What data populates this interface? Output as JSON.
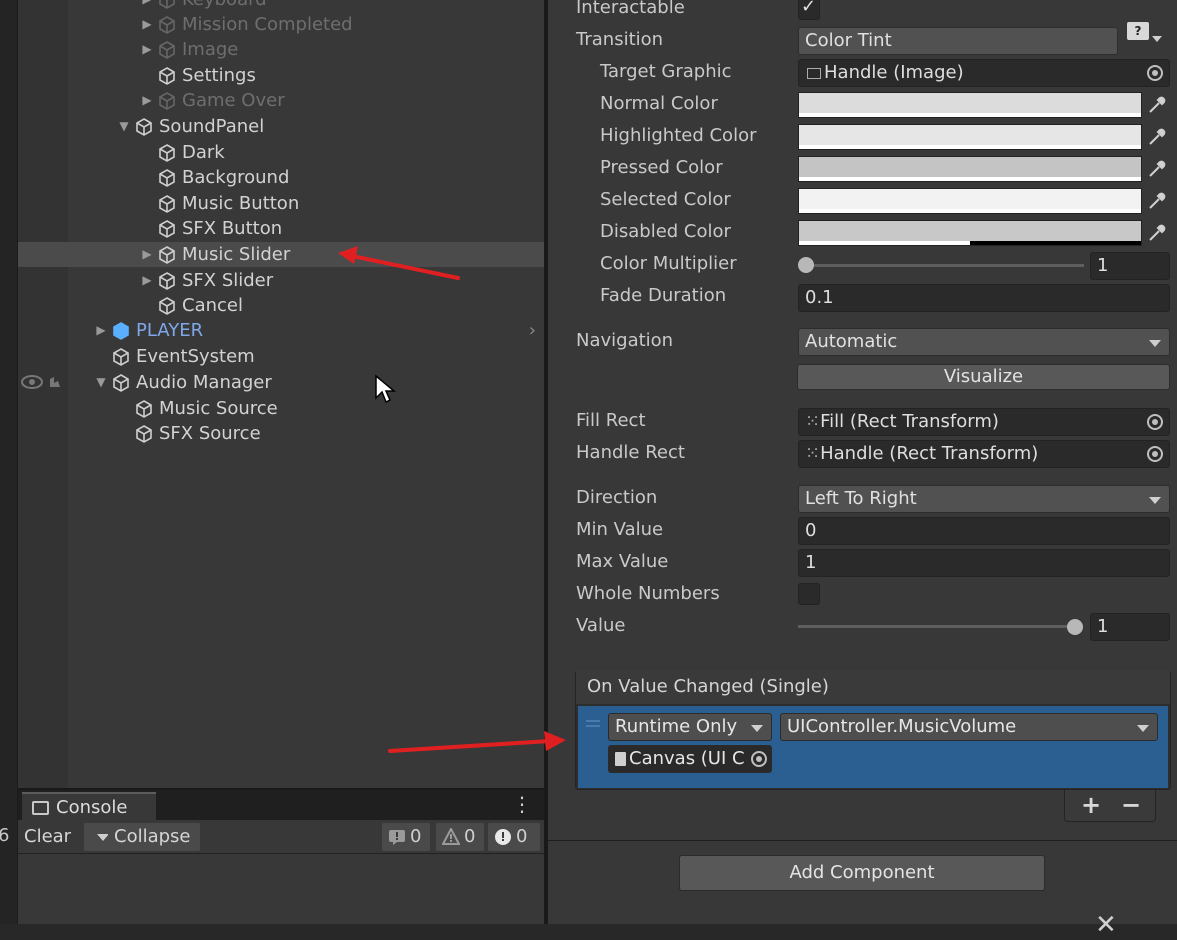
{
  "hierarchy": {
    "items": [
      {
        "label": "Keyboard",
        "state": "disabled"
      },
      {
        "label": "Mission Completed",
        "state": "disabled"
      },
      {
        "label": "Image",
        "state": "disabled"
      },
      {
        "label": "Settings",
        "state": "normal"
      },
      {
        "label": "Game Over",
        "state": "disabled"
      },
      {
        "label": "SoundPanel",
        "state": "expanded"
      },
      {
        "label": "Dark",
        "state": "normal"
      },
      {
        "label": "Background",
        "state": "normal"
      },
      {
        "label": "Music Button",
        "state": "normal"
      },
      {
        "label": "SFX Button",
        "state": "normal"
      },
      {
        "label": "Music Slider",
        "state": "selected"
      },
      {
        "label": "SFX Slider",
        "state": "collapsed"
      },
      {
        "label": "Cancel",
        "state": "normal"
      },
      {
        "label": "PLAYER",
        "state": "prefab"
      },
      {
        "label": "EventSystem",
        "state": "normal"
      },
      {
        "label": "Audio Manager",
        "state": "expanded"
      },
      {
        "label": "Music Source",
        "state": "normal"
      },
      {
        "label": "SFX Source",
        "state": "normal"
      }
    ]
  },
  "console": {
    "tab_label": "Console",
    "clear_label": "Clear",
    "collapse_label": "Collapse",
    "log_count": "0",
    "warning_count": "0",
    "error_count": "0",
    "edge_text": "6"
  },
  "inspector": {
    "interactable_label": "Interactable",
    "interactable_checked": true,
    "transition_label": "Transition",
    "transition_value": "Color Tint",
    "target_graphic_label": "Target Graphic",
    "target_graphic_value": "Handle (Image)",
    "normal_color_label": "Normal Color",
    "highlighted_color_label": "Highlighted Color",
    "pressed_color_label": "Pressed Color",
    "selected_color_label": "Selected Color",
    "disabled_color_label": "Disabled Color",
    "colors": {
      "normal": "#dcdcdc",
      "highlighted": "#e6e6e6",
      "pressed": "#c4c4c4",
      "selected": "#f2f2f2",
      "disabled": "#c8c8c8"
    },
    "color_multiplier_label": "Color Multiplier",
    "color_multiplier_value": "1",
    "fade_duration_label": "Fade Duration",
    "fade_duration_value": "0.1",
    "navigation_label": "Navigation",
    "navigation_value": "Automatic",
    "visualize_label": "Visualize",
    "fill_rect_label": "Fill Rect",
    "fill_rect_value": "Fill (Rect Transform)",
    "handle_rect_label": "Handle Rect",
    "handle_rect_value": "Handle (Rect Transform)",
    "direction_label": "Direction",
    "direction_value": "Left To Right",
    "min_value_label": "Min Value",
    "min_value": "0",
    "max_value_label": "Max Value",
    "max_value": "1",
    "whole_numbers_label": "Whole Numbers",
    "whole_numbers_checked": false,
    "value_label": "Value",
    "value": "1",
    "event_title": "On Value Changed (Single)",
    "event_runtime": "Runtime Only",
    "event_function": "UIController.MusicVolume",
    "event_object": "Canvas (UI C",
    "add_component_label": "Add Component"
  },
  "icons": [
    "cube-icon",
    "prefab-cube-icon",
    "eye-icon",
    "hand-icon",
    "console-icon",
    "info-icon",
    "warning-icon",
    "error-icon",
    "eyedropper-icon",
    "object-picker-icon",
    "help-icon",
    "script-icon",
    "rect-transform-icon",
    "image-icon",
    "red-annotation-arrow",
    "mouse-cursor-icon"
  ],
  "accent_colors": {
    "selection": "#4b4b4b",
    "event_row": "#2b5f92",
    "annotation": "#e02020",
    "prefab": "#7fa8e8"
  }
}
